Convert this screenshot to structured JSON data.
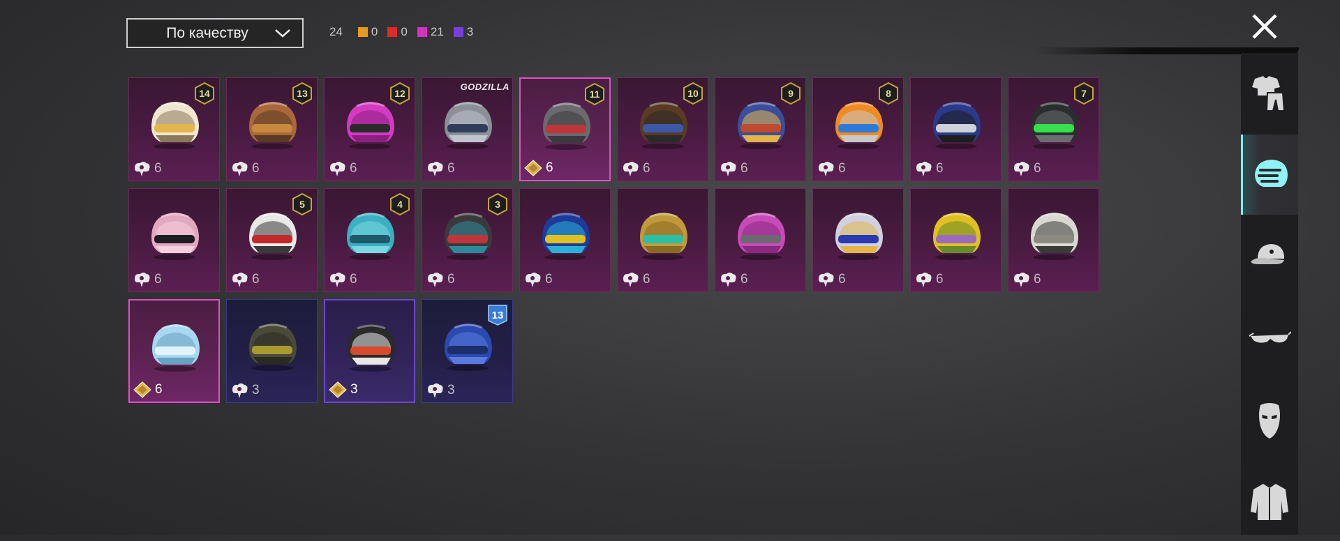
{
  "toolbar": {
    "sort_label": "По качеству",
    "total_count": "24",
    "rarity_counts": [
      {
        "color": "#e89a1c",
        "count": "0"
      },
      {
        "color": "#e02a2a",
        "count": "0"
      },
      {
        "color": "#d433c0",
        "count": "21"
      },
      {
        "color": "#7a3ee0",
        "count": "3"
      }
    ]
  },
  "items": [
    {
      "level": "14",
      "currency": "coupon",
      "count": "6",
      "palette": [
        "#f1e6d0",
        "#e2b64a",
        "#8a7a5a"
      ]
    },
    {
      "level": "13",
      "currency": "coupon",
      "count": "6",
      "palette": [
        "#a8683a",
        "#c8893e",
        "#5a3a22"
      ]
    },
    {
      "level": "12",
      "currency": "coupon",
      "count": "6",
      "palette": [
        "#d43ac2",
        "#2a2a2a",
        "#8a1f80"
      ]
    },
    {
      "level": "",
      "currency": "coupon",
      "count": "6",
      "label": "GODZILLA",
      "palette": [
        "#8a8f98",
        "#2e3e5a",
        "#c0c4cc"
      ]
    },
    {
      "level": "11",
      "currency": "gem",
      "count": "6",
      "selected": true,
      "palette": [
        "#6a6a6e",
        "#c0343a",
        "#3a3a3e"
      ]
    },
    {
      "level": "10",
      "currency": "coupon",
      "count": "6",
      "palette": [
        "#5a3a22",
        "#3e58a8",
        "#2a2a2a"
      ]
    },
    {
      "level": "9",
      "currency": "coupon",
      "count": "6",
      "palette": [
        "#3a4e9a",
        "#c04a2e",
        "#e2b64a"
      ]
    },
    {
      "level": "8",
      "currency": "coupon",
      "count": "6",
      "palette": [
        "#f08a22",
        "#2e7ad8",
        "#c8c8c8"
      ]
    },
    {
      "level": "",
      "currency": "coupon",
      "count": "6",
      "palette": [
        "#2a3a8a",
        "#d0d0d8",
        "#1e1e1e"
      ]
    },
    {
      "level": "7",
      "currency": "coupon",
      "count": "6",
      "palette": [
        "#2a2e2e",
        "#36e04a",
        "#6a6e6e"
      ]
    },
    {
      "level": "",
      "currency": "coupon",
      "count": "6",
      "palette": [
        "#e2a8c0",
        "#1e1e22",
        "#f4d0dc"
      ]
    },
    {
      "level": "5",
      "currency": "coupon",
      "count": "6",
      "palette": [
        "#e8e8e8",
        "#c02a2a",
        "#3a3a3a"
      ]
    },
    {
      "level": "4",
      "currency": "coupon",
      "count": "6",
      "palette": [
        "#3ab0c0",
        "#1e5a6a",
        "#7ad8e0"
      ]
    },
    {
      "level": "3",
      "currency": "coupon",
      "count": "6",
      "palette": [
        "#3a3a3e",
        "#c0343a",
        "#2e8a9a"
      ]
    },
    {
      "level": "",
      "currency": "coupon",
      "count": "6",
      "palette": [
        "#1e3a9a",
        "#e0c020",
        "#2ab0d8"
      ]
    },
    {
      "level": "",
      "currency": "coupon",
      "count": "6",
      "palette": [
        "#c09a3a",
        "#2ac0a8",
        "#8a6a22"
      ]
    },
    {
      "level": "",
      "currency": "coupon",
      "count": "6",
      "palette": [
        "#c84ab8",
        "#6a6a70",
        "#8a2a80"
      ]
    },
    {
      "level": "",
      "currency": "coupon",
      "count": "6",
      "palette": [
        "#d0d0e0",
        "#2a3ab0",
        "#e2b64a"
      ]
    },
    {
      "level": "",
      "currency": "coupon",
      "count": "6",
      "palette": [
        "#e0c020",
        "#9a6ac0",
        "#6a8a2a"
      ]
    },
    {
      "level": "",
      "currency": "coupon",
      "count": "6",
      "palette": [
        "#d8d8d0",
        "#8a8a80",
        "#3a3a38"
      ]
    },
    {
      "level": "",
      "currency": "gem",
      "count": "6",
      "selected": true,
      "palette": [
        "#a8d8f0",
        "#e0f4fc",
        "#6aa0c0"
      ]
    },
    {
      "level": "",
      "currency": "coupon",
      "count": "3",
      "blue": true,
      "palette": [
        "#4a4a38",
        "#a89a30",
        "#2a2a22"
      ]
    },
    {
      "level": "",
      "currency": "gem",
      "count": "3",
      "purple": true,
      "palette": [
        "#2a2a2a",
        "#d84a2e",
        "#e8e8e8"
      ]
    },
    {
      "level": "13",
      "currency": "coupon",
      "count": "3",
      "blue": true,
      "pass": true,
      "palette": [
        "#2a4ab0",
        "#1e2e6a",
        "#5a7ae0"
      ]
    }
  ],
  "sidebar": [
    "outfit-icon",
    "helmet-icon",
    "cap-icon",
    "glasses-icon",
    "mask-icon",
    "jacket-icon"
  ],
  "colors": {
    "accent": "#7ef0f5",
    "card_border": "#6c2a5c",
    "selected_border": "#e04fc7"
  }
}
